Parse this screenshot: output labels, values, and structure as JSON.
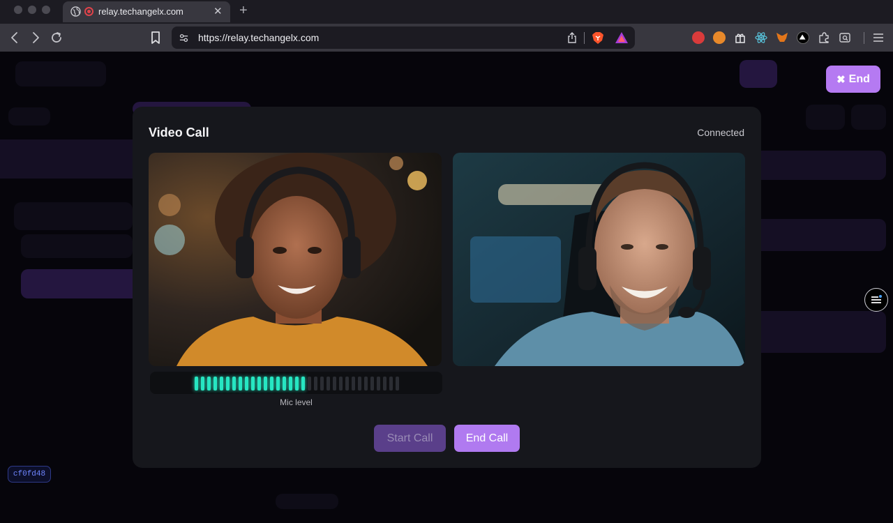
{
  "browser": {
    "tab_title": "relay.techangelx.com",
    "url": "https://relay.techangelx.com",
    "extension_icons": [
      "red-extension-icon",
      "orange-extension-icon",
      "gift-extension-icon",
      "react-devtools-icon",
      "metamask-fox-icon",
      "triangle-extension-icon",
      "puzzle-extensions-icon",
      "reader-view-icon"
    ]
  },
  "page": {
    "end_button_label": "End",
    "end_button_icon": "close-icon",
    "commit_badge": "cf0fd48"
  },
  "modal": {
    "title": "Video Call",
    "status": "Connected",
    "mic_label": "Mic level",
    "mic_level": 0.55,
    "start_call_label": "Start Call",
    "end_call_label": "End Call",
    "start_call_disabled": true
  },
  "colors": {
    "accent": "#b57af2",
    "mic_active": "#27e6c2",
    "background": "#06050b",
    "modal": "#16171c"
  }
}
